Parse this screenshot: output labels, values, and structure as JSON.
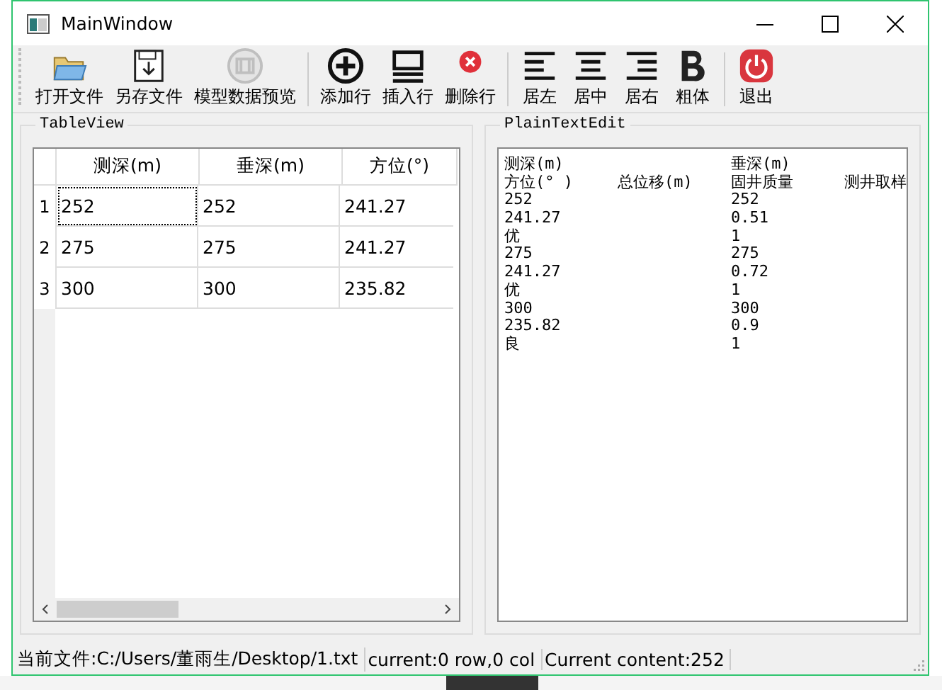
{
  "window": {
    "title": "MainWindow"
  },
  "toolbar": [
    {
      "kind": "open",
      "label": "打开文件",
      "disabled": false
    },
    {
      "kind": "save",
      "label": "另存文件",
      "disabled": false
    },
    {
      "kind": "preview",
      "label": "模型数据预览",
      "disabled": true
    },
    {
      "kind": "add",
      "label": "添加行",
      "disabled": false
    },
    {
      "kind": "insert",
      "label": "插入行",
      "disabled": false
    },
    {
      "kind": "delete",
      "label": "删除行",
      "disabled": false
    },
    {
      "kind": "left",
      "label": "居左",
      "disabled": false
    },
    {
      "kind": "center",
      "label": "居中",
      "disabled": false
    },
    {
      "kind": "right",
      "label": "居右",
      "disabled": false
    },
    {
      "kind": "bold",
      "label": "粗体",
      "disabled": false
    },
    {
      "kind": "exit",
      "label": "退出",
      "disabled": false
    }
  ],
  "table_view": {
    "title": "TableView",
    "columns": [
      "测深(m)",
      "垂深(m)",
      "方位(°)"
    ],
    "rows": [
      {
        "header": "1",
        "cells": [
          "252",
          "252",
          "241.27"
        ],
        "focused": true
      },
      {
        "header": "2",
        "cells": [
          "275",
          "275",
          "241.27"
        ],
        "focused": false
      },
      {
        "header": "3",
        "cells": [
          "300",
          "300",
          "235.82"
        ],
        "focused": false
      }
    ]
  },
  "plain_text_edit": {
    "title": "PlainTextEdit",
    "lines": [
      {
        "column_1": "测深(m)",
        "column_3": "垂深(m)"
      },
      {
        "column_1": "方位(° )",
        "column_2": "总位移(m)",
        "column_3": "固井质量",
        "column_4": "测井取样"
      },
      {
        "column_1": "252",
        "column_3": "252"
      },
      {
        "column_1": "241.27",
        "column_3": "0.51"
      },
      {
        "column_1": "优",
        "column_3": "1"
      },
      {
        "column_1": "275",
        "column_3": "275"
      },
      {
        "column_1": "241.27",
        "column_3": "0.72"
      },
      {
        "column_1": "优",
        "column_3": "1"
      },
      {
        "column_1": "300",
        "column_3": "300"
      },
      {
        "column_1": "235.82",
        "column_3": "0.9"
      },
      {
        "column_1": "良",
        "column_3": "1"
      }
    ]
  },
  "status_bar": [
    "当前文件:C:/Users/董雨生/Desktop/1.txt",
    "current:0 row,0 col",
    "Current content:252"
  ]
}
